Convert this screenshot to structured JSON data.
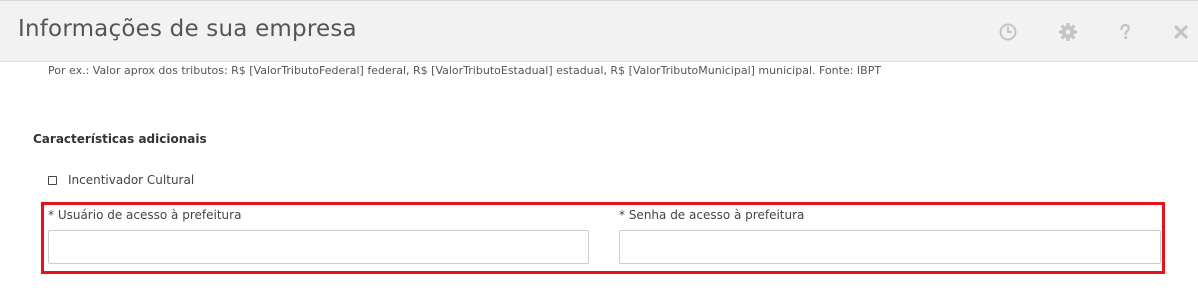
{
  "header": {
    "title": "Informações de sua empresa",
    "icons": [
      "clock-icon",
      "gear-icon",
      "question-icon",
      "close-icon"
    ],
    "icon_color": "#c4c4c4"
  },
  "hint": {
    "text": "Por ex.: Valor aprox dos tributos: R$ [ValorTributoFederal] federal, R$ [ValorTributoEstadual] estadual, R$ [ValorTributoMunicipal] municipal. Fonte: IBPT"
  },
  "section": {
    "title": "Características adicionais",
    "checkbox_label": "Incentivador Cultural",
    "checkbox_checked": false
  },
  "fields": {
    "user_label": "* Usuário de acesso à prefeitura",
    "user_value": "",
    "password_label": "* Senha de acesso à prefeitura",
    "password_value": ""
  },
  "colors": {
    "highlight": "#e8101d",
    "header_bg": "#f2f2f2"
  }
}
